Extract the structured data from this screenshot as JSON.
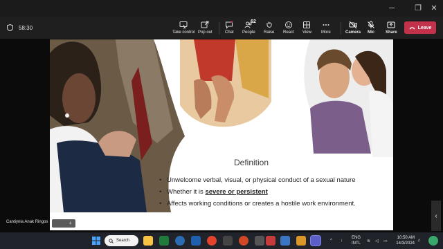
{
  "window": {
    "controls": [
      "─",
      "❐",
      "✕"
    ]
  },
  "toolbar": {
    "meeting_time": "58:30",
    "buttons": [
      {
        "label": "Take control",
        "icon": "take-control-icon"
      },
      {
        "label": "Pop out",
        "icon": "pop-out-icon"
      },
      {
        "label": "Chat",
        "icon": "chat-icon"
      },
      {
        "label": "People",
        "icon": "people-icon",
        "count": "62"
      },
      {
        "label": "Raise",
        "icon": "raise-hand-icon"
      },
      {
        "label": "React",
        "icon": "react-icon"
      },
      {
        "label": "View",
        "icon": "view-icon"
      },
      {
        "label": "More",
        "icon": "more-icon"
      },
      {
        "label": "Camera",
        "icon": "camera-off-icon"
      },
      {
        "label": "Mic",
        "icon": "mic-off-icon"
      },
      {
        "label": "Share",
        "icon": "share-icon"
      }
    ],
    "leave_label": "Leave"
  },
  "slide": {
    "title": "Definition",
    "bullets": [
      {
        "pre": "Unwelcome verbal, visual, or physical conduct of a sexual nature",
        "emph": "",
        "post": ""
      },
      {
        "pre": "Whether it is ",
        "emph": "severe or persistent",
        "post": ""
      },
      {
        "pre": "Affects working conditions or creates a hostile work environment.",
        "emph": "",
        "post": ""
      }
    ]
  },
  "presenter": {
    "name": "Cantiynia Anak Ringos",
    "mini_bar_symbol": "+"
  },
  "taskbar": {
    "search_label": "Search",
    "tray": {
      "lang_line1": "ENG",
      "lang_line2": "INTL",
      "time": "10:50 AM",
      "date": "14/3/2024"
    }
  }
}
